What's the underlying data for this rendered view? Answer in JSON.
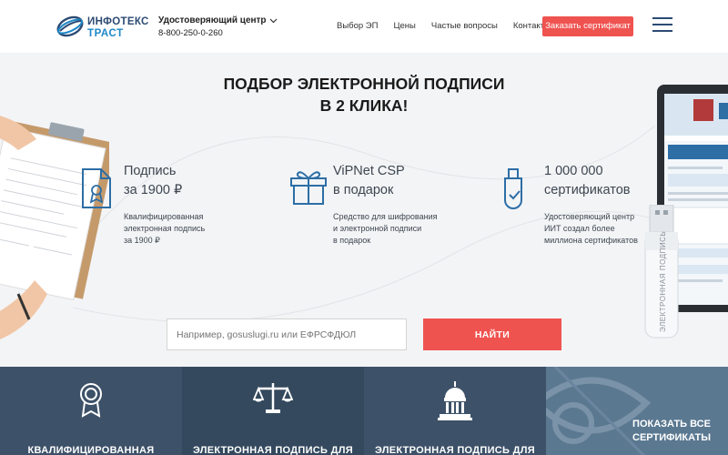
{
  "header": {
    "logo_line1": "ИНФОТЕКС",
    "logo_line2": "ТРАСТ",
    "uc_title": "Удостоверяющий центр",
    "uc_phone": "8-800-250-0-260",
    "nav": [
      "Выбор ЭП",
      "Цены",
      "Частые вопросы",
      "Контакты"
    ],
    "order_label": "Заказать сертификат"
  },
  "hero": {
    "headline_line1": "ПОДБОР ЭЛЕКТРОННОЙ ПОДПИСИ",
    "headline_line2": "В 2 КЛИКА!",
    "features": [
      {
        "icon": "certificate-document-icon",
        "title_line1": "Подпись",
        "title_line2": "за 1900 ₽",
        "desc_line1": "Квалифицированная",
        "desc_line2": "электронная подпись",
        "desc_line3": "за 1900 ₽"
      },
      {
        "icon": "gift-box-icon",
        "title_line1": "ViPNet CSP",
        "title_line2": "в подарок",
        "desc_line1": "Средство для шифрования",
        "desc_line2": "и электронной подписи",
        "desc_line3": "в подарок"
      },
      {
        "icon": "usb-token-icon",
        "title_line1": "1 000 000",
        "title_line2": "сертификатов",
        "desc_line1": "Удостоверяющий центр",
        "desc_line2": "ИИТ создал более",
        "desc_line3": "миллиона сертификатов"
      }
    ],
    "search_placeholder": "Например, gosuslugi.ru или ЕФРСФДЮЛ",
    "find_label": "НАЙТИ",
    "usb_label": "ЭЛЕКТРОННАЯ ПОДПИСЬ"
  },
  "categories": [
    {
      "icon": "award-ribbon-icon",
      "label": "КВАЛИФИЦИРОВАННАЯ",
      "color": "#3d5168"
    },
    {
      "icon": "scales-icon",
      "label": "ЭЛЕКТРОННАЯ ПОДПИСЬ ДЛЯ",
      "color": "#34495e"
    },
    {
      "icon": "capitol-building-icon",
      "label": "ЭЛЕКТРОННАЯ ПОДПИСЬ ДЛЯ",
      "color": "#3d5168"
    }
  ],
  "show_all": {
    "line1": "ПОКАЗАТЬ ВСЕ",
    "line2": "СЕРТИФИКАТЫ",
    "icon": "eye-icon",
    "color": "#5b7891"
  },
  "colors": {
    "accent": "#ef5350",
    "brand_dark": "#2c4a73",
    "brand_blue": "#1e88c8",
    "icon_blue": "#2d6ea5"
  }
}
